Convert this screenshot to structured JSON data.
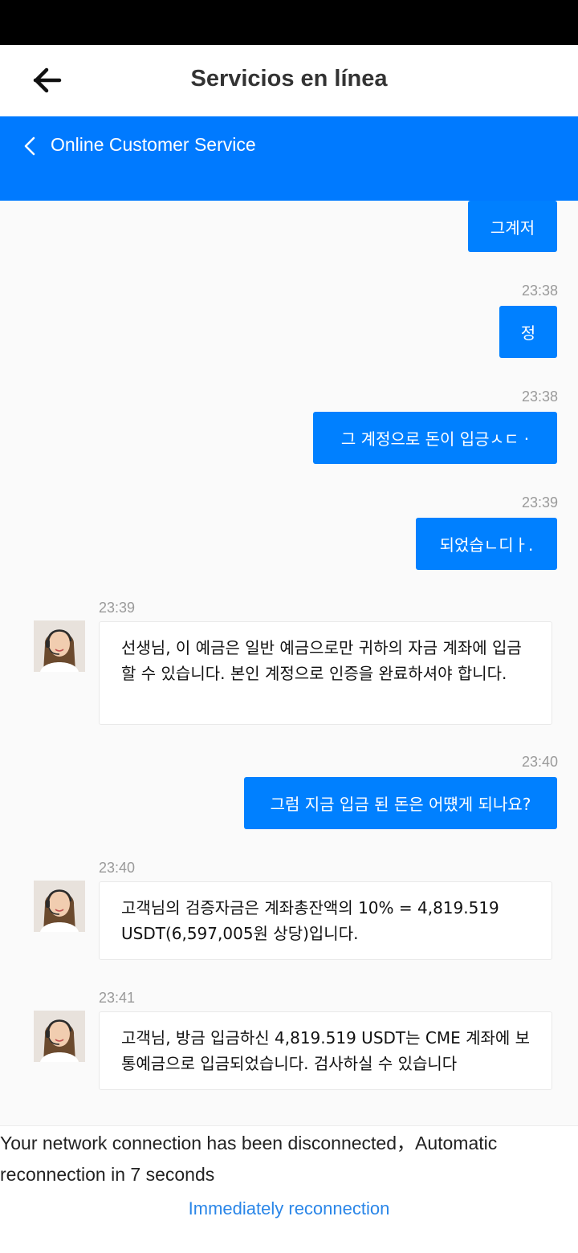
{
  "header": {
    "title": "Servicios en línea",
    "back_icon": "arrow-left-icon"
  },
  "service_bar": {
    "title": "Online Customer Service",
    "back_icon": "chevron-left-icon",
    "color": "#007aff"
  },
  "messages": [
    {
      "side": "out",
      "text": "그계저"
    },
    {
      "side": "out",
      "time": "23:38",
      "text": "정"
    },
    {
      "side": "out",
      "time": "23:38",
      "text": "그 계정으로 돈이 입긍ㅅㄷ ·"
    },
    {
      "side": "out",
      "time": "23:39",
      "text": "되었습ㄴ디ㅏ."
    },
    {
      "side": "in",
      "time": "23:39",
      "text": "선생님, 이 예금은 일반 예금으로만 귀하의 자금 계좌에 입금할 수 있습니다. 본인 계정으로 인증을 완료하셔야 합니다."
    },
    {
      "side": "out",
      "time": "23:40",
      "text": "그럼 지금 입금 된 돈은 어떘게 되나요?"
    },
    {
      "side": "in",
      "time": "23:40",
      "text": "고객님의 검증자금은 계좌총잔액의 10% = 4,819.519 USDT(6,597,005원 상당)입니다."
    },
    {
      "side": "in",
      "time": "23:41",
      "text": "고객님, 방금 입금하신 4,819.519 USDT는 CME 계좌에 보통예금으로 입금되었습니다. 검사하실 수 있습니다"
    }
  ],
  "connection": {
    "status_text": "Your network connection has been disconnected，Automatic reconnection in 7 seconds",
    "reconnect_label": "Immediately reconnection"
  },
  "colors": {
    "outgoing_bubble": "#0080ff",
    "link": "#2a86e8"
  }
}
